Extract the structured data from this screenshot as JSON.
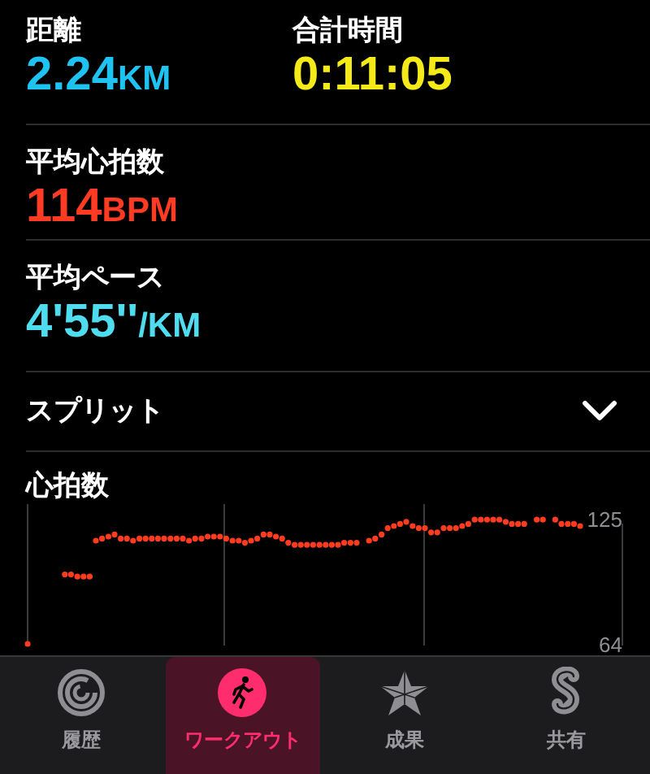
{
  "metrics_row": [
    {
      "label": "距離",
      "value": "2.24",
      "unit": "KM",
      "color": "#1fc3f2"
    },
    {
      "label": "合計時間",
      "value": "0:11:05",
      "color": "#f4ea1a"
    }
  ],
  "metrics": [
    {
      "label": "平均心拍数",
      "value": "114",
      "unit": "BPM",
      "color": "#ff3b24"
    },
    {
      "label": "平均ペース",
      "value": "4'55''",
      "unit": "/KM",
      "color": "#4fdcef"
    }
  ],
  "splits": {
    "label": "スプリット",
    "expanded": false
  },
  "heart_rate": {
    "title": "心拍数",
    "scale_labels": [
      "125",
      "64"
    ]
  },
  "tabs": [
    {
      "label": "履歴",
      "selected": false
    },
    {
      "label": "ワークアウト",
      "selected": true
    },
    {
      "label": "成果",
      "selected": false
    },
    {
      "label": "共有",
      "selected": false
    }
  ]
}
